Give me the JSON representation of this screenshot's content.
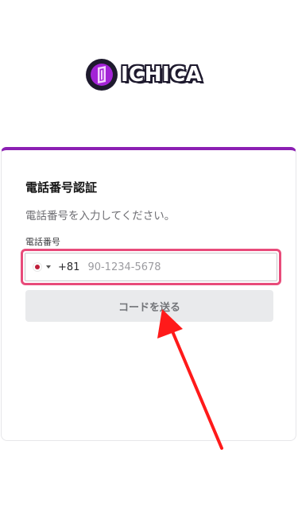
{
  "brand": {
    "name": "ICHICA",
    "accent": "#8b1fb3",
    "logo_icon": "ichica-logo-icon"
  },
  "card": {
    "title": "電話番号認証",
    "subtitle": "電話番号を入力してください。"
  },
  "phone": {
    "label": "電話番号",
    "flag_icon": "japan-flag-icon",
    "dial_code": "+81",
    "placeholder": "90-1234-5678",
    "value": ""
  },
  "send_button": {
    "label": "コードを送る"
  },
  "annotation": {
    "highlight_color": "#e84b7a",
    "arrow_color": "#ff1a1a"
  }
}
